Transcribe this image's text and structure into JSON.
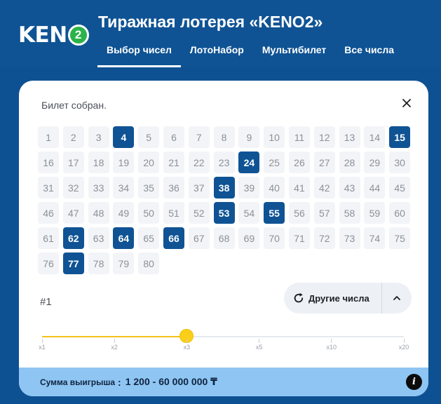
{
  "header": {
    "logo_text": "KEN",
    "logo_badge": "2",
    "title": "Тиражная лотерея «KENO2»",
    "tabs": [
      {
        "label": "Выбор чисел",
        "active": true
      },
      {
        "label": "ЛотоНабор",
        "active": false
      },
      {
        "label": "Мультибилет",
        "active": false
      },
      {
        "label": "Все числа",
        "active": false
      }
    ]
  },
  "ticket": {
    "status": "Билет собран.",
    "number_label": "#1",
    "numbers": [
      1,
      2,
      3,
      4,
      5,
      6,
      7,
      8,
      9,
      10,
      11,
      12,
      13,
      14,
      15,
      16,
      17,
      18,
      19,
      20,
      21,
      22,
      23,
      24,
      25,
      26,
      27,
      28,
      29,
      30,
      31,
      32,
      33,
      34,
      35,
      36,
      37,
      38,
      39,
      40,
      41,
      42,
      43,
      44,
      45,
      46,
      47,
      48,
      49,
      50,
      51,
      52,
      53,
      54,
      55,
      56,
      57,
      58,
      59,
      60,
      61,
      62,
      63,
      64,
      65,
      66,
      67,
      68,
      69,
      70,
      71,
      72,
      73,
      74,
      75,
      76,
      77,
      78,
      79,
      80
    ],
    "selected": [
      4,
      15,
      24,
      38,
      53,
      55,
      62,
      64,
      66,
      77
    ],
    "refresh_label": "Другие числа"
  },
  "multiplier": {
    "options": [
      "x1",
      "x2",
      "x3",
      "x5",
      "x10",
      "x20"
    ],
    "selected_index": 2
  },
  "footer": {
    "label": "Сумма выигрыша",
    "colon": ":",
    "amount": "1 200 - 60 000 000 ₸"
  },
  "icons": {
    "close": "close-icon",
    "refresh": "refresh-icon",
    "chevron": "chevron-up-icon",
    "info": "info-icon"
  },
  "colors": {
    "header_bg": "#0f5394",
    "selected_cell": "#0f5394",
    "unselected_cell": "#f3f4f7",
    "slider_knob": "#f9cf1a",
    "footer_bg": "#8ec5f3",
    "logo_badge": "#2bb34a"
  }
}
